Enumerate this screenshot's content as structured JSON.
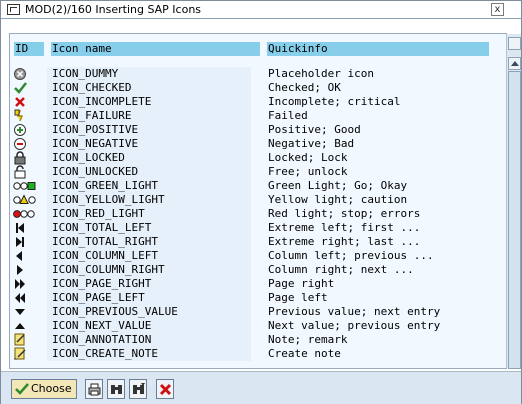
{
  "window": {
    "title": "MOD(2)/160 Inserting SAP Icons",
    "close_label": "x"
  },
  "columns": {
    "id": "ID",
    "name": "Icon name",
    "info": "Quickinfo"
  },
  "rows": [
    {
      "icon": "dummy-icon",
      "name": "ICON_DUMMY",
      "info": "Placeholder icon"
    },
    {
      "icon": "checkmark-icon",
      "name": "ICON_CHECKED",
      "info": "Checked; OK"
    },
    {
      "icon": "red-x-icon",
      "name": "ICON_INCOMPLETE",
      "info": "Incomplete; critical"
    },
    {
      "icon": "failure-icon",
      "name": "ICON_FAILURE",
      "info": "Failed"
    },
    {
      "icon": "plus-circle-icon",
      "name": "ICON_POSITIVE",
      "info": "Positive; Good"
    },
    {
      "icon": "minus-circle-icon",
      "name": "ICON_NEGATIVE",
      "info": "Negative; Bad"
    },
    {
      "icon": "lock-closed-icon",
      "name": "ICON_LOCKED",
      "info": "Locked; Lock"
    },
    {
      "icon": "lock-open-icon",
      "name": "ICON_UNLOCKED",
      "info": "Free; unlock"
    },
    {
      "icon": "green-light-icon",
      "name": "ICON_GREEN_LIGHT",
      "info": "Green Light; Go; Okay"
    },
    {
      "icon": "yellow-light-icon",
      "name": "ICON_YELLOW_LIGHT",
      "info": "Yellow light; caution"
    },
    {
      "icon": "red-light-icon",
      "name": "ICON_RED_LIGHT",
      "info": "Red light; stop; errors"
    },
    {
      "icon": "total-left-icon",
      "name": "ICON_TOTAL_LEFT",
      "info": "Extreme left; first ..."
    },
    {
      "icon": "total-right-icon",
      "name": "ICON_TOTAL_RIGHT",
      "info": "Extreme right; last ..."
    },
    {
      "icon": "column-left-icon",
      "name": "ICON_COLUMN_LEFT",
      "info": "Column left; previous ..."
    },
    {
      "icon": "column-right-icon",
      "name": "ICON_COLUMN_RIGHT",
      "info": "Column right; next ..."
    },
    {
      "icon": "page-right-icon",
      "name": "ICON_PAGE_RIGHT",
      "info": "Page right"
    },
    {
      "icon": "page-left-icon",
      "name": "ICON_PAGE_LEFT",
      "info": "Page left"
    },
    {
      "icon": "previous-value-icon",
      "name": "ICON_PREVIOUS_VALUE",
      "info": "Previous value; next entry"
    },
    {
      "icon": "next-value-icon",
      "name": "ICON_NEXT_VALUE",
      "info": "Next value; previous entry"
    },
    {
      "icon": "annotation-icon",
      "name": "ICON_ANNOTATION",
      "info": "Note; remark"
    },
    {
      "icon": "create-note-icon",
      "name": "ICON_CREATE_NOTE",
      "info": "Create note"
    }
  ],
  "footer": {
    "choose_label": "Choose",
    "buttons": [
      "print-icon",
      "find-icon",
      "find-next-icon",
      "cancel-icon"
    ]
  },
  "colors": {
    "header_bg": "#87ceeb",
    "list_bg": "#f2f8ff",
    "footer_bg": "#dae6f2",
    "choose_bg": "#f3e7b8"
  }
}
